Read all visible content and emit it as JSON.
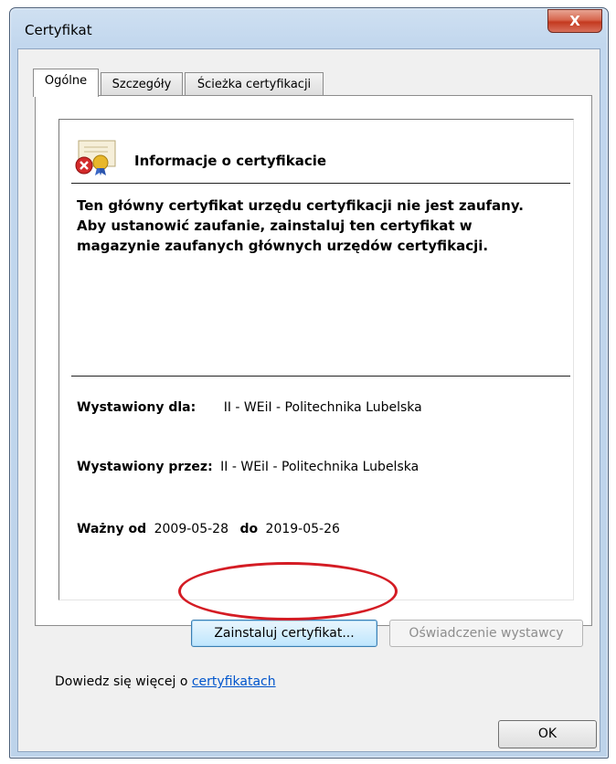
{
  "window": {
    "title": "Certyfikat",
    "close_label": "X"
  },
  "tabs": [
    {
      "label": "Ogólne",
      "active": true
    },
    {
      "label": "Szczegóły",
      "active": false
    },
    {
      "label": "Ścieżka certyfikacji",
      "active": false
    }
  ],
  "info": {
    "header": "Informacje o certyfikacie",
    "icon": "certificate-error-icon",
    "message": "Ten główny certyfikat urzędu certyfikacji nie jest zaufany. Aby ustanowić zaufanie, zainstaluj ten certyfikat w magazynie zaufanych głównych urzędów certyfikacji.",
    "issued_to_label": "Wystawiony dla:",
    "issued_to_value": "II - WEiI - Politechnika Lubelska",
    "issued_by_label": "Wystawiony przez:",
    "issued_by_value": "II - WEiI - Politechnika Lubelska",
    "valid_from_label": "Ważny od",
    "valid_from_value": "2009-05-28",
    "valid_to_label": "do",
    "valid_to_value": "2019-05-26"
  },
  "buttons": {
    "install": "Zainstaluj certyfikat...",
    "issuer_statement": "Oświadczenie wystawcy",
    "ok": "OK"
  },
  "learn_more": {
    "prefix": "Dowiedz się więcej o",
    "link": "certyfikatach"
  },
  "colors": {
    "annotation": "#d41c24",
    "link": "#0055cc",
    "close_button": "#c4391f"
  }
}
